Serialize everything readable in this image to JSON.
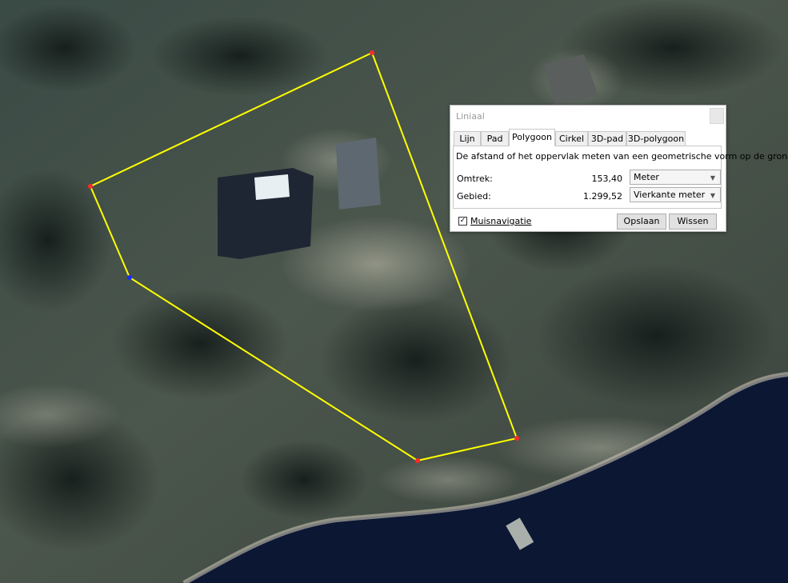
{
  "dialog": {
    "title": "Liniaal",
    "tabs": [
      "Lijn",
      "Pad",
      "Polygoon",
      "Cirkel",
      "3D-pad",
      "3D-polygoon"
    ],
    "active_tab": "Polygoon",
    "description": "De afstand of het oppervlak meten van een geometrische vorm op de grond",
    "perimeter": {
      "label": "Omtrek:",
      "value": "153,40",
      "unit": "Meter"
    },
    "area": {
      "label": "Gebied:",
      "value": "1.299,52",
      "unit": "Vierkante meter"
    },
    "mouse_nav": {
      "label": "Muisnavigatie",
      "checked": true
    },
    "save_label": "Opslaan",
    "clear_label": "Wissen"
  },
  "colors": {
    "polygon_line": "#ffff00",
    "vertex": "#ff2a2a",
    "active_vertex": "#1a2cff",
    "water": "#0b1733"
  }
}
